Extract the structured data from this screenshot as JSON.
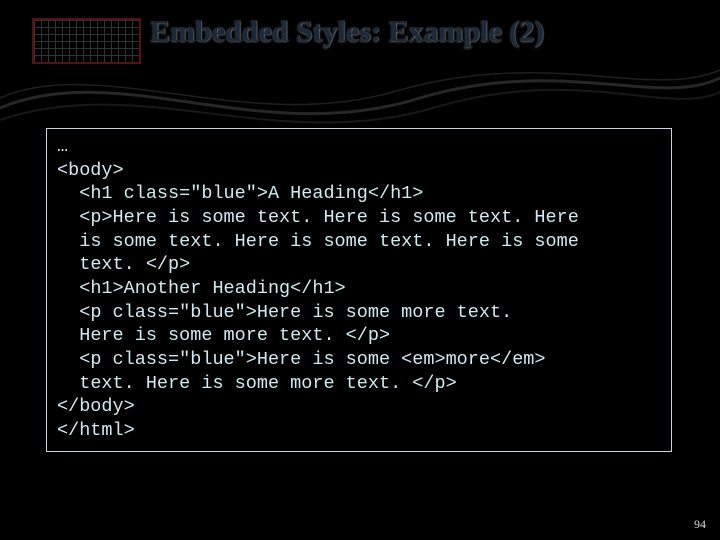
{
  "slide": {
    "title": "Embedded Styles: Example (2)",
    "page_number": "94",
    "code": "…\n<body>\n  <h1 class=\"blue\">A Heading</h1>\n  <p>Here is some text. Here is some text. Here\n  is some text. Here is some text. Here is some\n  text. </p>\n  <h1>Another Heading</h1>\n  <p class=\"blue\">Here is some more text.\n  Here is some more text. </p>\n  <p class=\"blue\">Here is some <em>more</em>\n  text. Here is some more text. </p>\n</body>\n</html>"
  }
}
